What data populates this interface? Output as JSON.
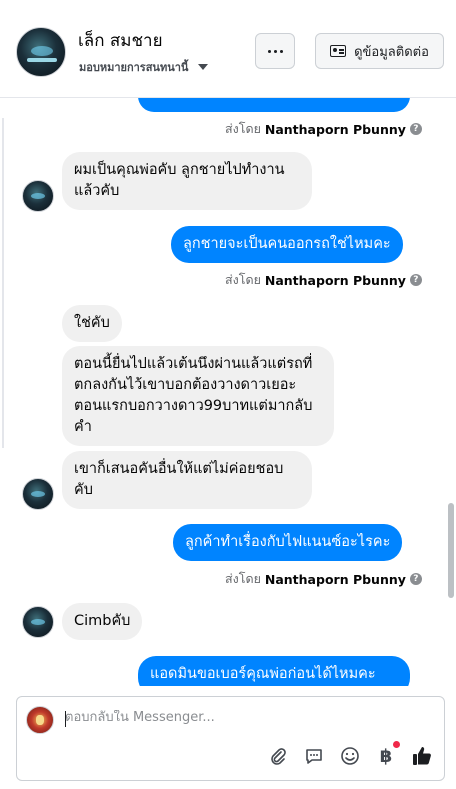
{
  "header": {
    "contact_name": "เล็ก สมชาย",
    "assign_label": "มอบหมายการสนทนานี้",
    "more_label": "...",
    "contact_info_label": "ดูข้อมูลติดต่อ"
  },
  "messages": [
    {
      "id": "m0",
      "direction": "out",
      "text": ""
    },
    {
      "id": "s0",
      "type": "sent_by",
      "prefix": "ส่งโดย",
      "agent": "Nanthaporn Pbunny"
    },
    {
      "id": "m1",
      "direction": "in",
      "text": "ผมเป็นคุณพ่อคับ ลูกชายไปทำงานแล้วคับ"
    },
    {
      "id": "m2",
      "direction": "out",
      "text": "ลูกชายจะเป็นคนออกรถใช่ไหมคะ"
    },
    {
      "id": "s2",
      "type": "sent_by",
      "prefix": "ส่งโดย",
      "agent": "Nanthaporn Pbunny"
    },
    {
      "id": "m3",
      "direction": "in",
      "text": "ใช่คับ"
    },
    {
      "id": "m4",
      "direction": "in",
      "text": "ตอนนี้ยื่นไปแล้วเต้นนึงผ่านแล้วแต่รถที่ตกลงกันไว้เขาบอกต้องวางดาวเยอะตอนแรกบอกวางดาว99บาทแต่มากลับคำ"
    },
    {
      "id": "m5",
      "direction": "in",
      "text": "เขาก็เสนอคันอื่นให้แต่ไม่ค่อยชอบคับ"
    },
    {
      "id": "m6",
      "direction": "out",
      "text": "ลูกค้าทำเรื่องกับไฟแนนซ์อะไรคะ"
    },
    {
      "id": "s6",
      "type": "sent_by",
      "prefix": "ส่งโดย",
      "agent": "Nanthaporn Pbunny"
    },
    {
      "id": "m7",
      "direction": "in",
      "text": "Cimbคับ"
    },
    {
      "id": "m8",
      "direction": "out",
      "text": "แอดมินขอเบอร์คุณพ่อก่อนได้ไหมคะ"
    }
  ],
  "composer": {
    "placeholder": "ตอบกลับใน Messenger...",
    "tools": [
      "attachment-icon",
      "chat-bubble-icon",
      "emoji-icon",
      "baht-icon",
      "like-icon"
    ],
    "baht_symbol": "฿"
  },
  "colors": {
    "outgoing_bubble": "#0084ff",
    "incoming_bubble": "#f0f0f0",
    "notification_dot": "#f02849"
  }
}
